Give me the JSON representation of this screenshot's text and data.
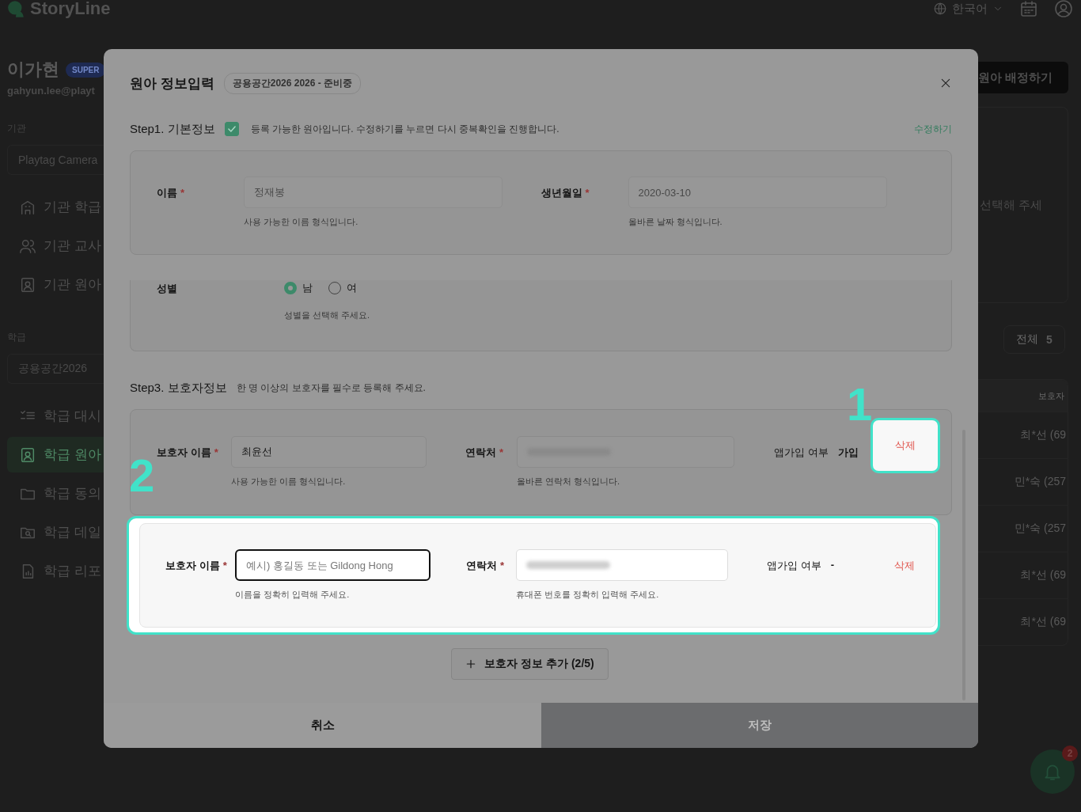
{
  "app": {
    "logo": "StoryLine",
    "language": "한국어",
    "user": {
      "name": "이가현",
      "badge": "SUPER",
      "email": "gahyun.lee@playt"
    },
    "sidebar": {
      "org_label": "기관",
      "org_select": "Playtag Camera",
      "org_items": [
        {
          "label": "기관 학급",
          "selected": false
        },
        {
          "label": "기관 교사",
          "selected": false
        },
        {
          "label": "기관 원아",
          "selected": false
        }
      ],
      "class_label": "학급",
      "class_select": "공용공간2026",
      "class_items": [
        {
          "label": "학급 대시",
          "selected": false
        },
        {
          "label": "학급 원아",
          "selected": true
        },
        {
          "label": "학급 동의",
          "selected": false
        },
        {
          "label": "학급 데일",
          "selected": false
        },
        {
          "label": "학급 리포",
          "selected": false
        }
      ]
    },
    "main": {
      "assign_button": "원아 배정하기",
      "hint": "선택해 주세",
      "total_label": "전체",
      "total_count": "5",
      "table": {
        "columns": [
          "보호자"
        ],
        "rows": [
          "최*선 (69",
          "민*숙 (257",
          "민*숙 (257",
          "최*선 (69",
          "최*선 (69"
        ]
      }
    },
    "notifications": {
      "count": "2"
    }
  },
  "modal": {
    "title": "원아 정보입력",
    "chip": "공용공간2026 2026 - 준비중",
    "step1": {
      "title": "Step1. 기본정보",
      "checked": true,
      "message": "등록 가능한 원아입니다. 수정하기를 누르면 다시 중복확인을 진행합니다.",
      "edit_link": "수정하기"
    },
    "basic_fields": [
      {
        "label": "이름",
        "mark": "*",
        "value": "정재봉",
        "hint": "사용 가능한 이름 형식입니다."
      },
      {
        "label": "생년월일",
        "mark": "*",
        "value": "2020-03-10",
        "hint": "올바른 날짜 형식입니다."
      }
    ],
    "gender": {
      "label": "성별",
      "options": [
        {
          "label": "남",
          "selected": true
        },
        {
          "label": "여",
          "selected": false
        }
      ],
      "hint": "성별을 선택해 주세요."
    },
    "step3": {
      "title": "Step3. 보호자정보",
      "message": "한 명 이상의 보호자를 필수로 등록해 주세요."
    },
    "guardians": [
      {
        "highlighted": false,
        "name_label": "보호자 이름",
        "mark": "*",
        "name_value": "최윤선",
        "name_focused": false,
        "name_hint": "사용 가능한 이름 형식입니다.",
        "phone_label": "연락처",
        "phone_hint": "올바른 연락처 형식입니다.",
        "app_label": "앱가입 여부",
        "app_value": "가입",
        "delete": "삭제",
        "delete_highlighted": true
      },
      {
        "highlighted": true,
        "name_label": "보호자 이름",
        "mark": "*",
        "name_placeholder": "예시) 홍길동 또는 Gildong Hong",
        "name_focused": true,
        "name_hint": "이름을 정확히 입력해 주세요.",
        "phone_label": "연락처",
        "phone_hint": "휴대폰 번호를 정확히 입력해 주세요.",
        "app_label": "앱가입 여부",
        "app_value": "-",
        "delete": "삭제",
        "delete_highlighted": false
      }
    ],
    "add_button": "보호자 정보 추가 (2/5)",
    "cancel": "취소",
    "save": "저장",
    "save_disabled": true
  },
  "callouts": [
    {
      "label": "1"
    },
    {
      "label": "2"
    }
  ]
}
